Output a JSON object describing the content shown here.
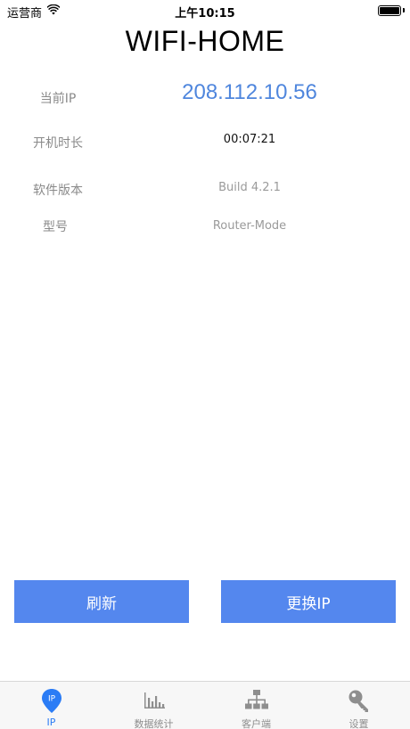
{
  "status_bar": {
    "carrier": "运营商",
    "time": "上午10:15"
  },
  "app": {
    "title": "WIFI-HOME"
  },
  "info": {
    "ip_label": "当前IP",
    "ip_value": "208.112.10.56",
    "uptime_label": "开机时长",
    "uptime_value": "00:07:21",
    "version_label": "软件版本",
    "version_value": "Build 4.2.1",
    "model_label": "型号",
    "model_value": "Router-Mode"
  },
  "actions": {
    "refresh_label": "刷新",
    "change_ip_label": "更换IP"
  },
  "tabs": [
    {
      "label": "IP",
      "icon": "location-pin-icon",
      "icon_text": "IP",
      "active": true
    },
    {
      "label": "数据统计",
      "icon": "bar-chart-icon",
      "active": false
    },
    {
      "label": "客户端",
      "icon": "network-tree-icon",
      "active": false
    },
    {
      "label": "设置",
      "icon": "key-icon",
      "active": false
    }
  ],
  "colors": {
    "accent": "#5487ee",
    "ip_text": "#4f86dd",
    "tab_active": "#2b7cf5",
    "tab_inactive": "#8e8e8e"
  }
}
